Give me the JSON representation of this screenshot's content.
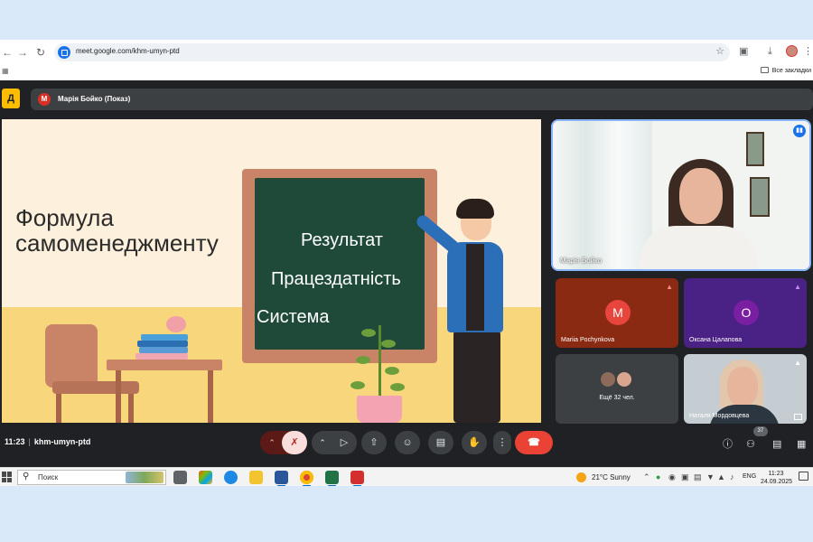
{
  "browser": {
    "url": "meet.google.com/khm-umyn-ptd",
    "bookmarks_label": "Все закладки"
  },
  "meet": {
    "presenter_avatar_letter": "M",
    "presenter_label": "Марія Бойко (Показ)",
    "slide": {
      "title_line1": "Формула",
      "title_line2": "самоменеджменту",
      "board_lines": [
        "Результат",
        "Працездатність",
        "Система"
      ]
    },
    "self_view": {
      "name": "Марія Бойко"
    },
    "tiles": [
      {
        "name": "Mariia Pochynkova",
        "avatar_letter": "M",
        "avatar_color": "#e8453c",
        "bg_color": "#8a2a12"
      },
      {
        "name": "Оксана Цалапова",
        "avatar_letter": "О",
        "avatar_color": "#7b1fa2",
        "bg_color": "#4a2185"
      },
      {
        "label": "Ещё 32 чел.",
        "bg_color": "#3c4043"
      },
      {
        "name": "Наталя Мордовцева",
        "bg_color": "#c6cdd2"
      }
    ],
    "time": "11:23",
    "meeting_code": "khm-umyn-ptd",
    "participants_count": "37",
    "colors": {
      "end_call": "#ea4335",
      "accent": "#8ab4f8",
      "brand": "#fbbc04"
    }
  },
  "taskbar": {
    "search_label": "Поиск",
    "weather": "21°C  Sunny",
    "language": "ENG",
    "clock_time": "11:23",
    "clock_date": "24.09.2025"
  }
}
